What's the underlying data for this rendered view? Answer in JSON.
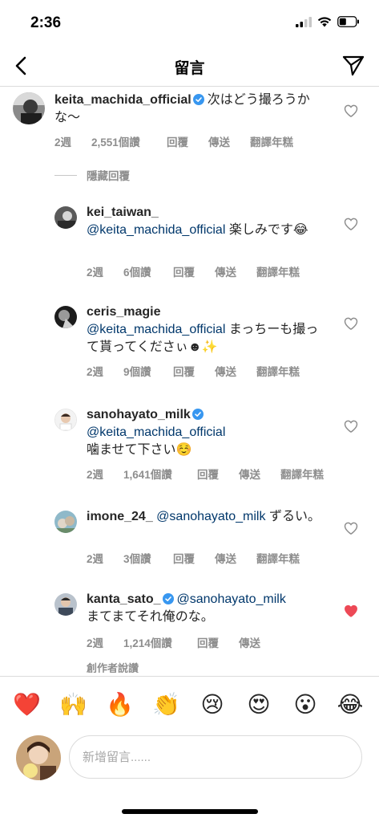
{
  "status_bar": {
    "time": "2:36"
  },
  "header": {
    "title": "留言"
  },
  "parent_comment": {
    "username": "keita_machida_official",
    "verified": true,
    "text": "次はどう撮ろうかな〜",
    "time": "2週",
    "likes": "2,551個讚",
    "reply": "回覆",
    "send": "傳送",
    "translate": "翻譯年糕"
  },
  "hide_replies_label": "隱藏回覆",
  "replies": [
    {
      "username": "kei_taiwan_",
      "verified": false,
      "mention": "@keita_machida_official",
      "text": "楽しみです😂",
      "time": "2週",
      "likes": "6個讚",
      "reply": "回覆",
      "send": "傳送",
      "translate": "翻譯年糕",
      "liked": false
    },
    {
      "username": "ceris_magie",
      "verified": false,
      "mention": "@keita_machida_official",
      "text": "まっちーも撮って貰ってくださぃ☻✨",
      "time": "2週",
      "likes": "9個讚",
      "reply": "回覆",
      "send": "傳送",
      "translate": "翻譯年糕",
      "liked": false
    },
    {
      "username": "sanohayato_milk",
      "verified": true,
      "mention": "@keita_machida_official",
      "text": "噛ませて下さい☺️",
      "time": "2週",
      "likes": "1,641個讚",
      "reply": "回覆",
      "send": "傳送",
      "translate": "翻譯年糕",
      "liked": false
    },
    {
      "username": "imone_24_",
      "verified": false,
      "mention": "@sanohayato_milk",
      "text": "ずるい。",
      "time": "2週",
      "likes": "3個讚",
      "reply": "回覆",
      "send": "傳送",
      "translate": "翻譯年糕",
      "liked": false
    },
    {
      "username": "kanta_sato_",
      "verified": true,
      "mention": "@sanohayato_milk",
      "text": "まてまてそれ俺のな。",
      "time": "2週",
      "likes": "1,214個讚",
      "reply": "回覆",
      "send": "傳送",
      "translate": "",
      "liked": true
    }
  ],
  "creator_liked": "創作者說讚",
  "emoji_bar": [
    "❤️",
    "🙌",
    "🔥",
    "👏",
    "😢",
    "😍",
    "😮",
    "😂"
  ],
  "composer": {
    "placeholder": "新增留言......"
  },
  "colors": {
    "like_red": "#ed4956",
    "verified_blue": "#3897f0",
    "mention": "#00376b",
    "meta_gray": "#8e8e8e"
  }
}
